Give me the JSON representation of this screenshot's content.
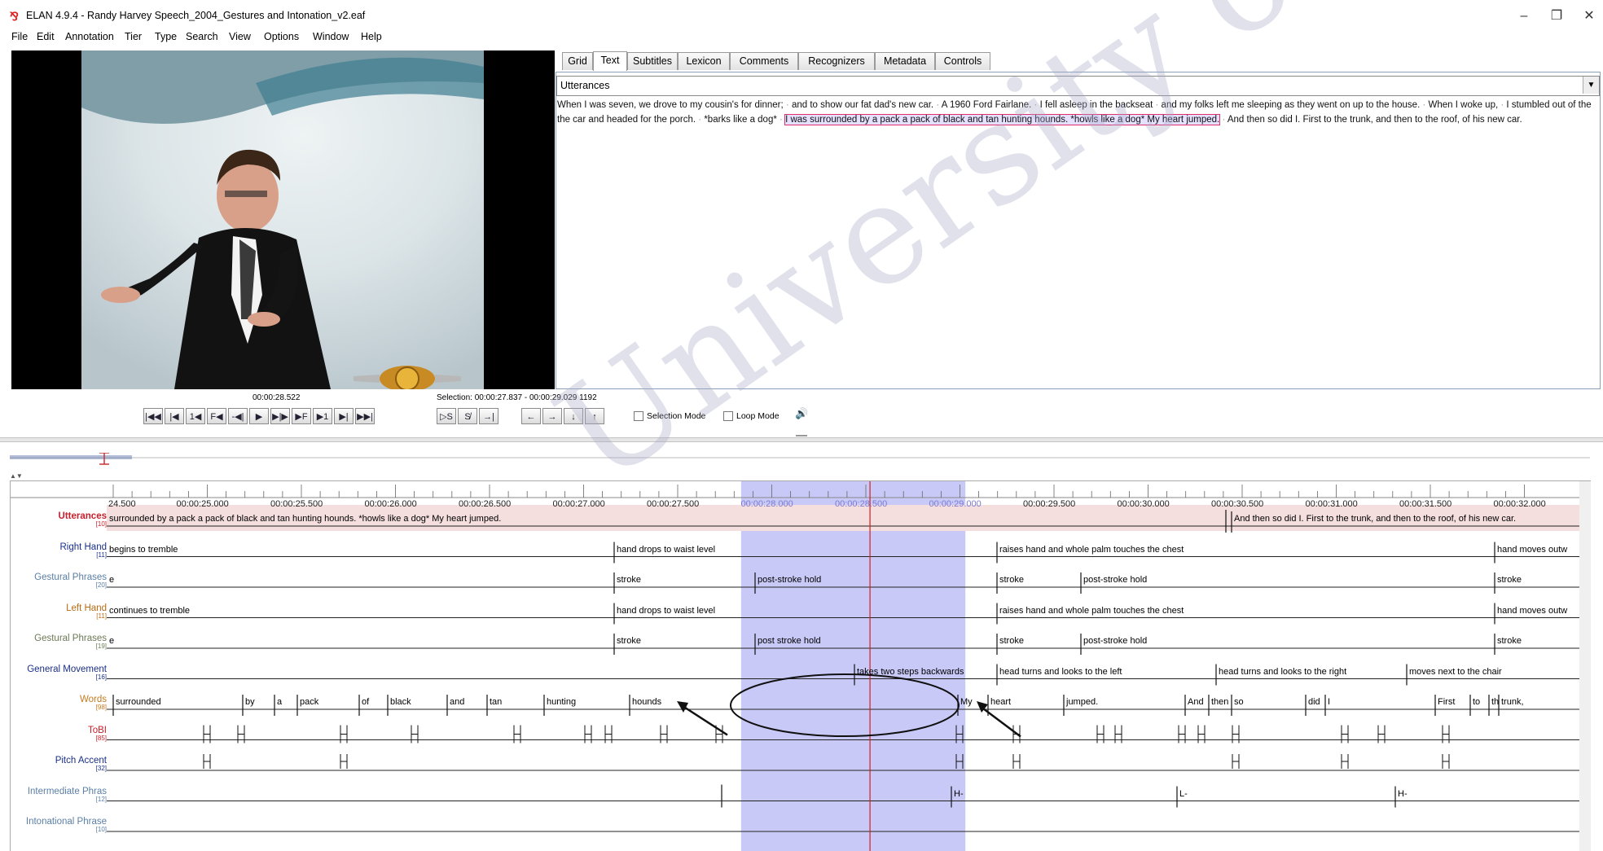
{
  "window": {
    "title": "ELAN 4.9.4 - Randy Harvey Speech_2004_Gestures and Intonation_v2.eaf",
    "controls": [
      "–",
      "❐",
      "✕"
    ]
  },
  "menu": [
    "File",
    "Edit",
    "Annotation",
    "Tier",
    "Type",
    "Search",
    "View",
    "Options",
    "Window",
    "Help"
  ],
  "tabs": [
    "Grid",
    "Text",
    "Subtitles",
    "Lexicon",
    "Comments",
    "Recognizers",
    "Metadata",
    "Controls"
  ],
  "active_tab": "Text",
  "text_panel": {
    "tier": "Utterances",
    "utterances_before": [
      "When I was seven, we drove to my cousin's for dinner;",
      "and to show our fat dad's new car.",
      "A 1960 Ford Fairlane.",
      "I fell asleep in the backseat",
      "and my folks left me sleeping as they went on up to the house.",
      "When I woke up,",
      "I stumbled out of the the car and headed for the porch.",
      "*barks like a dog*"
    ],
    "utterance_selected": "I was surrounded by a pack a pack of black and tan hunting hounds. *howls like a dog* My heart jumped.",
    "utterances_after": [
      "And then so did I. First to the trunk, and then to the roof, of his new car."
    ]
  },
  "player": {
    "current_time": "00:00:28.522",
    "selection": "Selection: 00:00:27.837 - 00:00:29.029  1192",
    "buttons": [
      "|◀◀",
      "|◀",
      "1◀",
      "F◀",
      "-◀|",
      "▶",
      "▶|▶",
      "▶F",
      "▶1",
      "▶|",
      "▶▶|"
    ],
    "sel_buttons": [
      "▷S",
      "S̸",
      "→|"
    ],
    "nav_buttons": [
      "←",
      "→",
      "↓",
      "↑"
    ],
    "selection_mode": "Selection Mode",
    "loop_mode": "Loop Mode",
    "volume_icon": "🔊"
  },
  "timeline": {
    "ticks": [
      "24.500",
      "00:00:25.000",
      "00:00:25.500",
      "00:00:26.000",
      "00:00:26.500",
      "00:00:27.000",
      "00:00:27.500",
      "00:00:28.000",
      "00:00:28.500",
      "00:00:29.000",
      "00:00:29.500",
      "00:00:30.000",
      "00:00:30.500",
      "00:00:31.000",
      "00:00:31.500",
      "00:00:32.000"
    ],
    "tiers": [
      {
        "name": "Utterances",
        "count": "[10]",
        "color": "#c8202a"
      },
      {
        "name": "Right Hand",
        "count": "[11]",
        "color": "#1a2f8a"
      },
      {
        "name": "Gestural Phrases",
        "count": "[20]",
        "color": "#5a7fa6"
      },
      {
        "name": "Left Hand",
        "count": "[11]",
        "color": "#b86a12"
      },
      {
        "name": "Gestural Phrases",
        "count": "[19]",
        "color": "#6a7a55"
      },
      {
        "name": "General Movement",
        "count": "[16]",
        "color": "#1a2f8a"
      },
      {
        "name": "Words",
        "count": "[98]",
        "color": "#c47a20"
      },
      {
        "name": "ToBI",
        "count": "[85]",
        "color": "#c8202a"
      },
      {
        "name": "Pitch Accent",
        "count": "[32]",
        "color": "#1a2f8a"
      },
      {
        "name": "Intermediate Phras",
        "count": "[12]",
        "color": "#5a7fa6"
      },
      {
        "name": "Intonational Phrase",
        "count": "[10]",
        "color": "#5a7fa6"
      }
    ],
    "annotations": {
      "utterances": [
        "surrounded by a pack a pack of black and tan hunting hounds. *howls like a dog* My heart jumped.",
        "And then so did I. First to the trunk, and then to the roof, of his new car."
      ],
      "right_hand": [
        "begins to tremble",
        "hand drops to waist level",
        "raises hand and whole palm touches the chest",
        "hand moves outw"
      ],
      "gestural_1": [
        "e",
        "stroke",
        "post-stroke hold",
        "stroke",
        "post-stroke hold",
        "stroke"
      ],
      "left_hand": [
        "continues to tremble",
        "hand drops to waist level",
        "raises hand and whole palm touches the chest",
        "hand moves outw"
      ],
      "gestural_2": [
        "e",
        "stroke",
        "post stroke hold",
        "stroke",
        "post-stroke hold",
        "stroke"
      ],
      "general_movement": [
        "takes two steps backwards",
        "head turns and looks to the left",
        "head turns and looks to the right",
        "moves next to the chair"
      ],
      "words": [
        "surrounded",
        "by",
        "a",
        "pack",
        "of",
        "black",
        "and",
        "tan",
        "hunting",
        "hounds",
        "My",
        "heart",
        "jumped.",
        "And",
        "then",
        "so",
        "did",
        "I",
        "First",
        "to",
        "th",
        "trunk,"
      ],
      "intermediate": [
        "H-",
        "L-",
        "H-"
      ]
    }
  },
  "watermark": "University of Malaya"
}
